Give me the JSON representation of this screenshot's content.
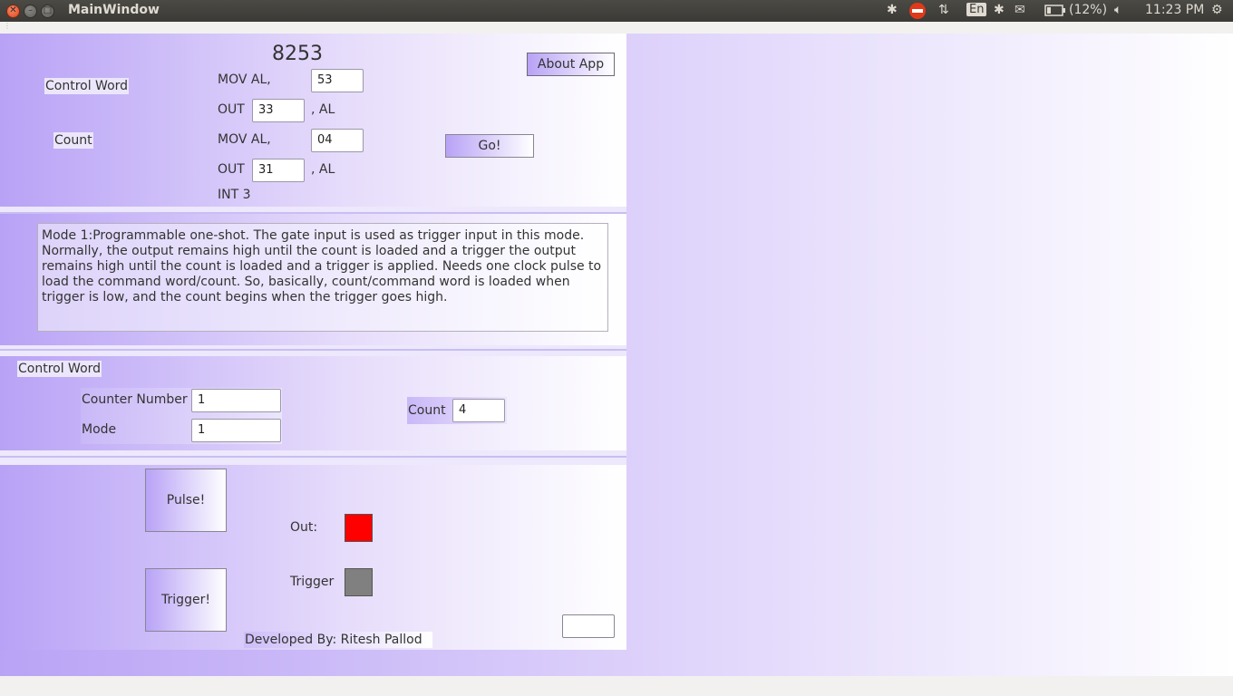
{
  "window": {
    "title": "MainWindow"
  },
  "tray": {
    "language": "En",
    "battery": "(12%)",
    "time": "11:23 PM"
  },
  "header": {
    "title": "8253",
    "about_button": "About App",
    "control_word_label": "Control Word",
    "count_label": "Count",
    "mov_label_1": "MOV AL,",
    "mov_value_1": "53",
    "out_label_1": "OUT",
    "out_value_1": "33",
    "out_suffix_1": ", AL",
    "mov_label_2": "MOV AL,",
    "mov_value_2": "04",
    "out_label_2": "OUT",
    "out_value_2": "31",
    "out_suffix_2": ", AL",
    "int_label": "INT 3",
    "go_button": "Go!"
  },
  "description": {
    "text": "Mode 1:Programmable one-shot. The gate input is used as trigger input in this mode. Normally, the output remains high until the count is loaded and a trigger the output remains high until the count is loaded and a trigger is applied. Needs one clock pulse to load the command word/count. So, basically, count/command word is loaded when trigger is low, and the count begins when the trigger goes high."
  },
  "control": {
    "section_label": "Control Word",
    "counter_number_label": "Counter Number",
    "counter_number_value": "1",
    "mode_label": "Mode",
    "mode_value": "1",
    "count_label": "Count",
    "count_value": "4"
  },
  "signals": {
    "pulse_button": "Pulse!",
    "trigger_button": "Trigger!",
    "out_label": "Out:",
    "trigger_label": "Trigger",
    "out_color": "#ff0000",
    "trigger_color": "#808080",
    "developer_label": "Developed By: Ritesh Pallod",
    "extra_field_value": ""
  }
}
